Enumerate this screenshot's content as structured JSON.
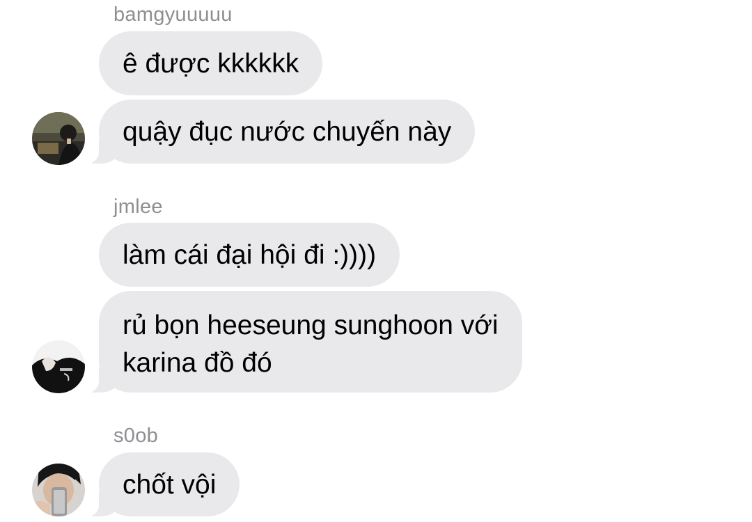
{
  "chat": {
    "groups": [
      {
        "sender": "bamgyuuuuu",
        "messages": [
          "ê được kkkkkk",
          "quậy đục nước chuyến này"
        ]
      },
      {
        "sender": "jmlee",
        "messages": [
          "làm cái đại hội đi :))))",
          "rủ bọn heeseung sunghoon với",
          "karina đồ đó"
        ]
      },
      {
        "sender": "s0ob",
        "messages": [
          "chốt vội"
        ]
      }
    ]
  },
  "colors": {
    "bubble_background": "#e9e9eb",
    "sender_text": "#8e8e93",
    "message_text": "#000000"
  },
  "icons": {
    "avatar_bamgyuuuuu": "user-avatar-photo",
    "avatar_jmlee": "user-avatar-photo",
    "avatar_s0ob": "user-avatar-photo"
  }
}
